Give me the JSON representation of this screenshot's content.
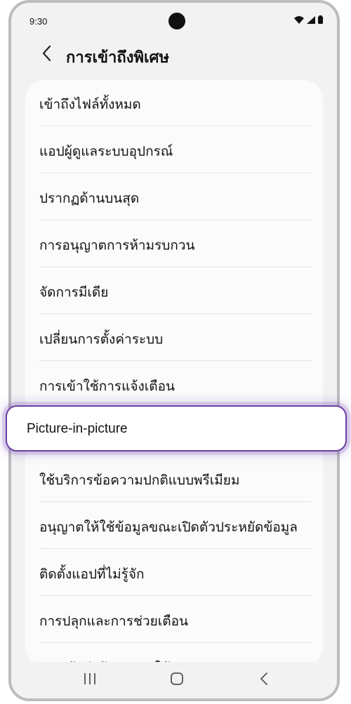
{
  "status_bar": {
    "time": "9:30",
    "icons": [
      "wifi-icon",
      "signal-icon",
      "battery-icon"
    ]
  },
  "header": {
    "title": "การเข้าถึงพิเศษ",
    "back_icon": "chevron-left-icon"
  },
  "items": [
    {
      "label": "เข้าถึงไฟล์ทั้งหมด"
    },
    {
      "label": "แอปผู้ดูแลระบบอุปกรณ์"
    },
    {
      "label": "ปรากฏด้านบนสุด"
    },
    {
      "label": "การอนุญาตการห้ามรบกวน"
    },
    {
      "label": "จัดการมีเดีย"
    },
    {
      "label": "เปลี่ยนการตั้งค่าระบบ"
    },
    {
      "label": "การเข้าใช้การแจ้งเตือน"
    },
    {
      "label": "Picture-in-picture"
    },
    {
      "label": "ใช้บริการข้อความปกติแบบพรีเมียม"
    },
    {
      "label": "อนุญาตให้ใช้ข้อมูลขณะเปิดตัวประหยัดข้อมูล"
    },
    {
      "label": "ติดตั้งแอปที่ไม่รู้จัก"
    },
    {
      "label": "การปลุกและการช่วยเตือน"
    },
    {
      "label": "การเข้าถึงข้อมูลการใช้"
    }
  ],
  "navigation": [
    "recents-icon",
    "home-icon",
    "back-icon"
  ],
  "colors": {
    "highlight_border": "#6b3fa3",
    "background": "#f2f2f2",
    "card": "#fbfbfb"
  }
}
